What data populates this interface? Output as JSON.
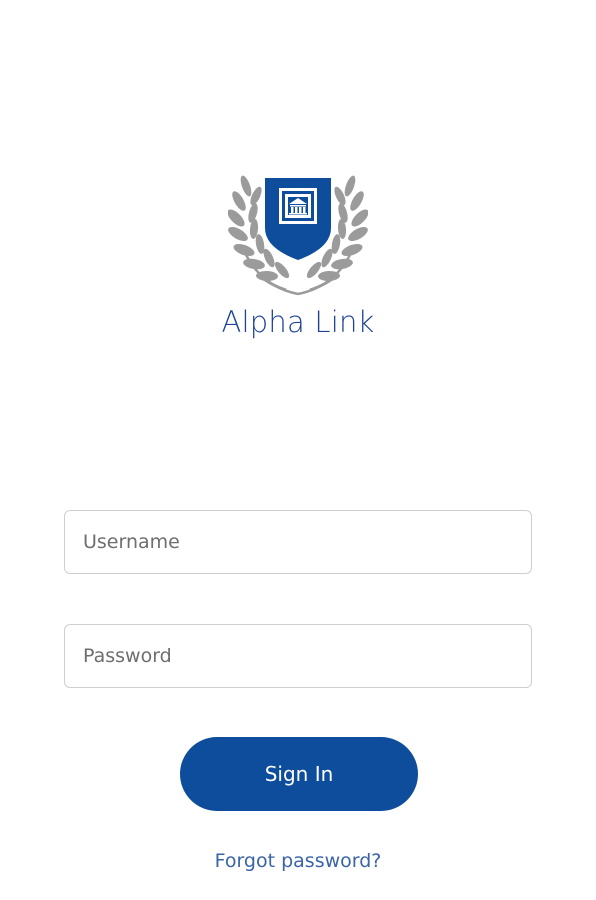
{
  "app": {
    "name": "Alpha Link"
  },
  "login": {
    "username_placeholder": "Username",
    "password_placeholder": "Password",
    "signin_label": "Sign In",
    "forgot_label": "Forgot password?"
  },
  "colors": {
    "brand_blue": "#0d4d9c",
    "title_blue": "#1d4396",
    "link_blue": "#3a64a8",
    "laurel_gray": "#9b9b9b"
  },
  "icons": {
    "logo": "shield-with-laurel-and-building-icon"
  }
}
